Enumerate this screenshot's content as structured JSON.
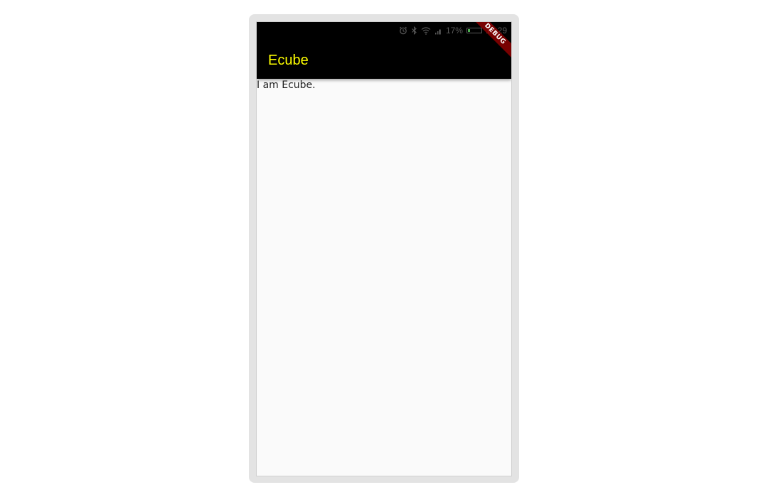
{
  "status_bar": {
    "battery_percent": "17%",
    "battery_level": 0.17,
    "time": "10:29",
    "icons": [
      "alarm-icon",
      "bluetooth-icon",
      "wifi-icon",
      "signal-icon",
      "battery-icon"
    ]
  },
  "app_bar": {
    "title": "Ecube",
    "background_color": "#000000",
    "title_color": "#ffff00"
  },
  "debug_banner": {
    "label": "DEBUG",
    "color": "#a00000"
  },
  "content": {
    "text": "I am Ecube."
  }
}
